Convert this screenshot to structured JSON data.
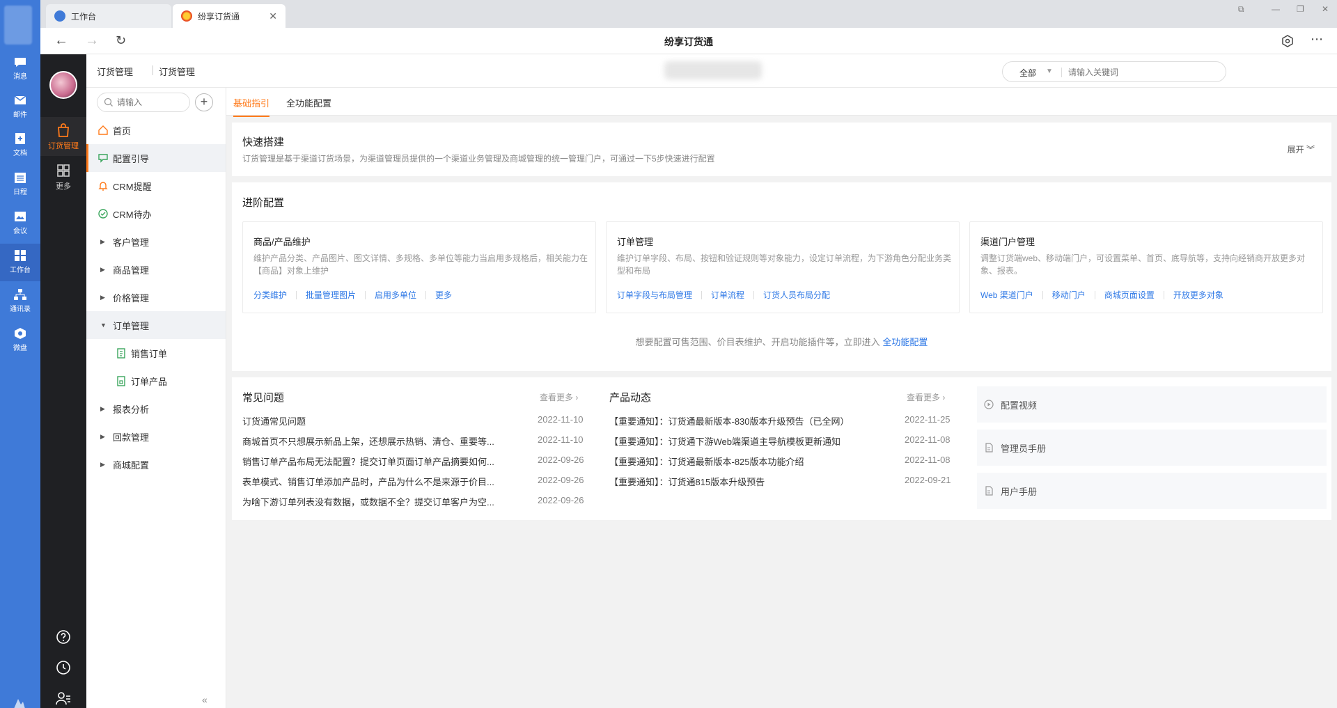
{
  "rail": {
    "items": [
      {
        "label": "消息"
      },
      {
        "label": "邮件"
      },
      {
        "label": "文档"
      },
      {
        "label": "日程"
      },
      {
        "label": "会议"
      },
      {
        "label": "工作台"
      },
      {
        "label": "通讯录"
      },
      {
        "label": "微盘"
      }
    ]
  },
  "dark": {
    "items": [
      {
        "label": "订货管理"
      },
      {
        "label": "更多"
      }
    ]
  },
  "tabs": [
    {
      "label": "工作台"
    },
    {
      "label": "纷享订货通"
    }
  ],
  "browser": {
    "title": "纷享订货通"
  },
  "header": {
    "breadcrumb_1": "订货管理",
    "breadcrumb_2": "订货管理",
    "search_scope": "全部",
    "search_placeholder": "请输入关键词"
  },
  "menu": {
    "search_placeholder": "请输入",
    "items": [
      {
        "label": "首页"
      },
      {
        "label": "配置引导"
      },
      {
        "label": "CRM提醒"
      },
      {
        "label": "CRM待办"
      },
      {
        "label": "客户管理"
      },
      {
        "label": "商品管理"
      },
      {
        "label": "价格管理"
      },
      {
        "label": "订单管理"
      },
      {
        "label": "销售订单"
      },
      {
        "label": "订单产品"
      },
      {
        "label": "报表分析"
      },
      {
        "label": "回款管理"
      },
      {
        "label": "商城配置"
      }
    ]
  },
  "content_tabs": [
    {
      "label": "基础指引"
    },
    {
      "label": "全功能配置"
    }
  ],
  "quick": {
    "title": "快速搭建",
    "desc": "订货管理是基于渠道订货场景，为渠道管理员提供的一个渠道业务管理及商城管理的统一管理门户，可通过一下5步快速进行配置",
    "expand": "展开"
  },
  "advanced": {
    "title": "进阶配置",
    "boxes": [
      {
        "title": "商品/产品维护",
        "desc": "维护产品分类、产品图片、图文详情、多规格、多单位等能力当启用多规格后，相关能力在【商品】对象上维护",
        "links": [
          "分类维护",
          "批量管理图片",
          "启用多单位",
          "更多"
        ]
      },
      {
        "title": "订单管理",
        "desc": "维护订单字段、布局、按钮和验证规则等对象能力，设定订单流程，为下游角色分配业务类型和布局",
        "links": [
          "订单字段与布局管理",
          "订单流程",
          "订货人员布局分配"
        ]
      },
      {
        "title": "渠道门户管理",
        "desc": "调整订货端web、移动端门户，可设置菜单、首页、底导航等，支持向经销商开放更多对象、报表。",
        "links": [
          "Web 渠道门户",
          "移动门户",
          "商城页面设置",
          "开放更多对象"
        ]
      }
    ],
    "footer_text": "想要配置可售范围、价目表维护、开启功能插件等，立即进入",
    "footer_link": "全功能配置"
  },
  "faq": {
    "title": "常见问题",
    "more": "查看更多",
    "rows": [
      {
        "text": "订货通常见问题",
        "date": "2022-11-10"
      },
      {
        "text": "商城首页不只想展示新品上架，还想展示热销、清仓、重要等...",
        "date": "2022-11-10"
      },
      {
        "text": "销售订单产品布局无法配置？提交订单页面订单产品摘要如何...",
        "date": "2022-09-26"
      },
      {
        "text": "表单模式、销售订单添加产品时，产品为什么不是来源于价目...",
        "date": "2022-09-26"
      },
      {
        "text": "为啥下游订单列表没有数据，或数据不全？提交订单客户为空...",
        "date": "2022-09-26"
      }
    ]
  },
  "news": {
    "title": "产品动态",
    "more": "查看更多",
    "rows": [
      {
        "text": "【重要通知】：订货通最新版本-830版本升级预告（已全网）",
        "date": "2022-11-25"
      },
      {
        "text": "【重要通知】：订货通下游Web端渠道主导航模板更新通知",
        "date": "2022-11-08"
      },
      {
        "text": "【重要通知】：订货通最新版本-825版本功能介绍",
        "date": "2022-11-08"
      },
      {
        "text": "【重要通知】：订货通815版本升级预告",
        "date": "2022-09-21"
      }
    ]
  },
  "resources": [
    {
      "label": "配置视频"
    },
    {
      "label": "管理员手册"
    },
    {
      "label": "用户手册"
    }
  ],
  "colors": {
    "accent": "#ff7a1a",
    "link": "#2e78e6",
    "rail": "#3f7ad8"
  }
}
